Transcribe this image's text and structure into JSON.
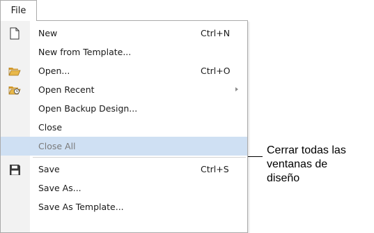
{
  "menu": {
    "title": "File",
    "items": [
      {
        "label": "New",
        "shortcut": "Ctrl+N",
        "icon": "new-document-icon"
      },
      {
        "label": "New from Template...",
        "shortcut": ""
      },
      {
        "label": "Open...",
        "shortcut": "Ctrl+O",
        "icon": "folder-open-icon"
      },
      {
        "label": "Open Recent",
        "shortcut": "",
        "icon": "folder-recent-icon",
        "submenu": true
      },
      {
        "label": "Open Backup Design...",
        "shortcut": ""
      },
      {
        "label": "Close",
        "shortcut": ""
      },
      {
        "label": "Close All",
        "shortcut": "",
        "state": "highlighted, disabled"
      },
      {
        "label": "Save",
        "shortcut": "Ctrl+S",
        "icon": "save-floppy-icon"
      },
      {
        "label": "Save As...",
        "shortcut": ""
      },
      {
        "label": "Save As Template...",
        "shortcut": ""
      }
    ]
  },
  "callout": {
    "lines": [
      "Cerrar todas las",
      "ventanas de",
      "diseño"
    ]
  },
  "colors": {
    "highlight": "#cfe0f3",
    "icon_gutter": "#f2f2f2",
    "folder": "#e8b84a",
    "border": "#aaaaaa"
  }
}
